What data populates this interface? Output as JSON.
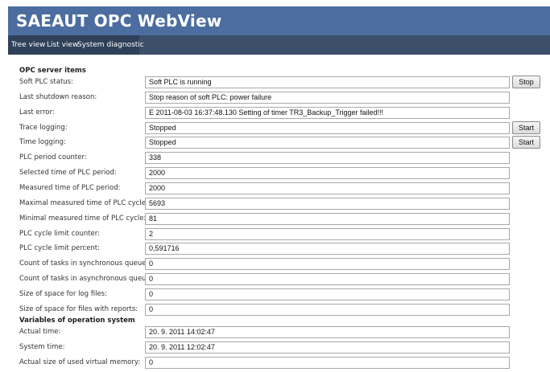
{
  "app": {
    "title": "SAEAUT OPC WebView"
  },
  "nav": {
    "items": [
      {
        "label": "Tree view"
      },
      {
        "label": "List view"
      },
      {
        "label": "System diagnostic"
      }
    ]
  },
  "sections": [
    {
      "title": "OPC server items",
      "rows": [
        {
          "label": "Soft PLC status:",
          "value": "Soft PLC is running",
          "button": "Stop"
        },
        {
          "label": "Last shutdown reason:",
          "value": "Stop reason of soft PLC: power failure"
        },
        {
          "label": "Last error:",
          "value": "E 2011-08-03 16:37:48.130  Setting of timer TR3_Backup_Trigger failed!!!"
        },
        {
          "label": "Trace logging:",
          "value": "Stopped",
          "button": "Start"
        },
        {
          "label": "Time logging:",
          "value": "Stopped",
          "button": "Start"
        },
        {
          "label": "PLC period counter:",
          "value": "338"
        },
        {
          "label": "Selected time of PLC period:",
          "value": "2000"
        },
        {
          "label": "Measured time of PLC period:",
          "value": "2000"
        },
        {
          "label": "Maximal measured time of PLC cycle:",
          "value": "5693"
        },
        {
          "label": "Minimal measured time of PLC cycle:",
          "value": "81"
        },
        {
          "label": "PLC cycle limit counter:",
          "value": "2"
        },
        {
          "label": "PLC cycle limit percent:",
          "value": "0,591716"
        },
        {
          "label": "Count of tasks in synchronous queue:",
          "value": "0"
        },
        {
          "label": "Count of tasks in asynchronous queue:",
          "value": "0"
        },
        {
          "label": "Size of space for log files:",
          "value": "0"
        },
        {
          "label": "Size of space for files with reports:",
          "value": "0"
        }
      ]
    },
    {
      "title": "Variables of operation system",
      "rows": [
        {
          "label": "Actual time:",
          "value": "20. 9. 2011 14:02:47"
        },
        {
          "label": "System time:",
          "value": "20. 9. 2011 12:02:47"
        },
        {
          "label": "Actual size of used virtual memory:",
          "value": "0"
        }
      ]
    }
  ]
}
